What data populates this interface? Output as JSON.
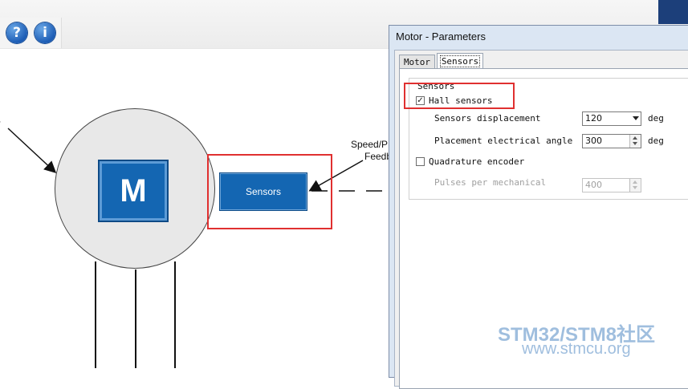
{
  "toolbar": {
    "help_icon_glyph": "?",
    "info_icon_glyph": "i"
  },
  "diagram": {
    "left_label_partial": "or",
    "motor_label": "M",
    "sensors_button_label": "Sensors",
    "speed_label_partial": "Speed/P",
    "feedback_label_partial": "Feedb"
  },
  "dialog": {
    "title": "Motor - Parameters",
    "tabs": [
      {
        "label": "Motor"
      },
      {
        "label": "Sensors"
      }
    ],
    "sensors_group": {
      "label": "Sensors",
      "hall_sensors": {
        "label": "Hall sensors",
        "checked": true,
        "check_glyph": "✓"
      },
      "sensors_displacement": {
        "label": "Sensors displacement",
        "value": "120",
        "unit": "deg"
      },
      "placement_electrical_angle": {
        "label": "Placement electrical angle",
        "value": "300",
        "unit": "deg"
      },
      "quadrature_encoder": {
        "label": "Quadrature encoder",
        "checked": false
      },
      "pulses_per_mechanical": {
        "label": "Pulses per mechanical",
        "value": "400",
        "enabled": false
      }
    }
  },
  "watermark": {
    "line1": "STM32/STM8社区",
    "line2": "www.stmcu.org"
  },
  "colors": {
    "accent_blue": "#1466b2",
    "highlight_red": "#e03030"
  }
}
